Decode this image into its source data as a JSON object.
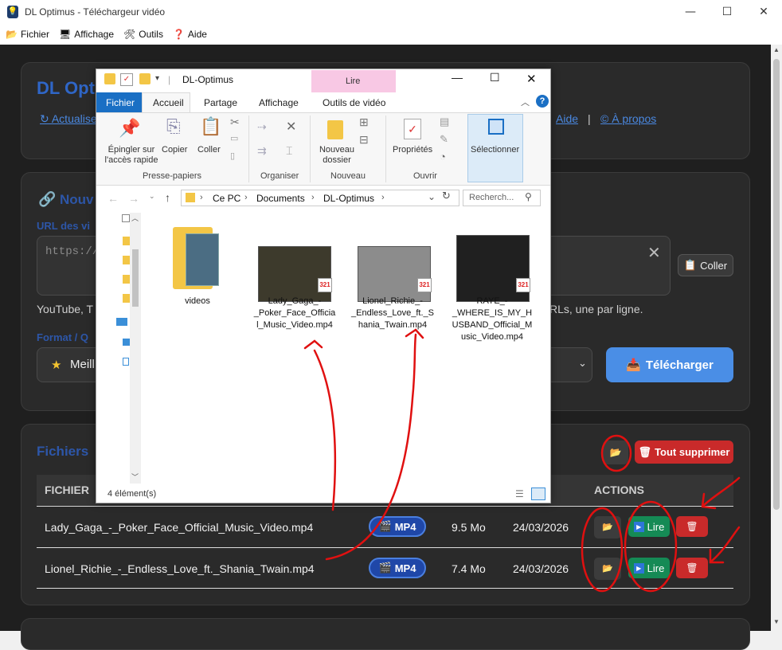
{
  "window": {
    "title": "DL Optimus - Téléchargeur vidéo",
    "app_icon": "bulb-icon"
  },
  "menu": [
    {
      "label": "Fichier",
      "icon": "📂"
    },
    {
      "label": "Affichage",
      "icon": "🖥"
    },
    {
      "label": "Outils",
      "icon": "🛠"
    },
    {
      "label": "Aide",
      "icon": "❓"
    }
  ],
  "header": {
    "brand": "DL Opt",
    "refresh_link": "↻ Actualise",
    "help_link": "Aide",
    "about_link": "© À propos",
    "separator": "|"
  },
  "new_download": {
    "title": "Nouv",
    "url_label": "URL des vi",
    "url_placeholder": "https://",
    "paste_label": "Coller",
    "hint_left": "YouTube, T",
    "hint_right": "RLs, une par ligne.",
    "format_label": "Format / Q",
    "format_value": "Meill",
    "download_label": "Télécharger"
  },
  "files": {
    "title": "Fichiers",
    "delete_all_label": "Tout supprimer",
    "columns": {
      "file": "FICHIER",
      "actions": "ACTIONS"
    },
    "rows": [
      {
        "name": "Lady_Gaga_-_Poker_Face_Official_Music_Video.mp4",
        "format": "MP4",
        "size": "9.5 Mo",
        "date": "24/03/2026",
        "play": "Lire"
      },
      {
        "name": "Lionel_Richie_-_Endless_Love_ft._Shania_Twain.mp4",
        "format": "MP4",
        "size": "7.4 Mo",
        "date": "24/03/2026",
        "play": "Lire"
      }
    ]
  },
  "explorer": {
    "title": "DL-Optimus",
    "context_tab": "Lire",
    "tabs": [
      "Fichier",
      "Accueil",
      "Partage",
      "Affichage",
      "Outils de vidéo"
    ],
    "ribbon": {
      "pin": "Épingler sur l'accès rapide",
      "copy": "Copier",
      "paste": "Coller",
      "clipboard_group": "Presse-papiers",
      "organize_group": "Organiser",
      "new_folder": "Nouveau dossier",
      "new_group": "Nouveau",
      "properties": "Propriétés",
      "open_group": "Ouvrir",
      "select": "Sélectionner"
    },
    "breadcrumb": [
      "Ce PC",
      "Documents",
      "DL-Optimus"
    ],
    "search_placeholder": "Recherch...",
    "items": [
      {
        "name": "videos",
        "type": "folder"
      },
      {
        "name": "Lady_Gaga_-_Poker_Face_Official_Music_Video.mp4",
        "type": "video"
      },
      {
        "name": "Lionel_Richie_-_Endless_Love_ft._Shania_Twain.mp4",
        "type": "video"
      },
      {
        "name": "RAYE_-_WHERE_IS_MY_HUSBAND_Official_Music_Video.mp4",
        "type": "video"
      }
    ],
    "status": "4 élément(s)"
  }
}
